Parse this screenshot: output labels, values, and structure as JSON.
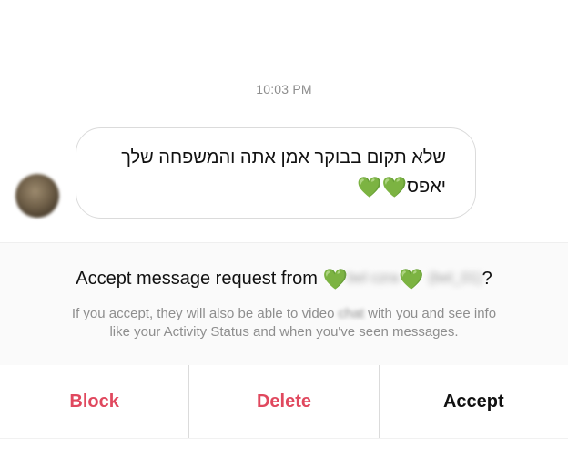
{
  "conversation": {
    "timestamp": "10:03 PM",
    "message": {
      "line1": "שלא תקום בבוקר אמן אתה והמשפחה שלך",
      "line2": "יאפס",
      "hearts": "💚💚"
    }
  },
  "request": {
    "title_prefix": "Accept message request from",
    "heart": "💚",
    "blurred_name": "bel czra",
    "blurred_username": "(bel_01)",
    "title_suffix": "?",
    "subtitle_part1": "If you accept, they will also be able to video",
    "subtitle_blurred": "chat",
    "subtitle_part2": "with you and see info",
    "subtitle_line2": "like your Activity Status and when you've seen messages."
  },
  "actions": {
    "block": "Block",
    "delete": "Delete",
    "accept": "Accept"
  },
  "colors": {
    "danger": "#e0485e",
    "heart": "#2fbf3a",
    "muted": "#8e8e8e"
  },
  "icons": {
    "heart": "green-heart-icon"
  }
}
